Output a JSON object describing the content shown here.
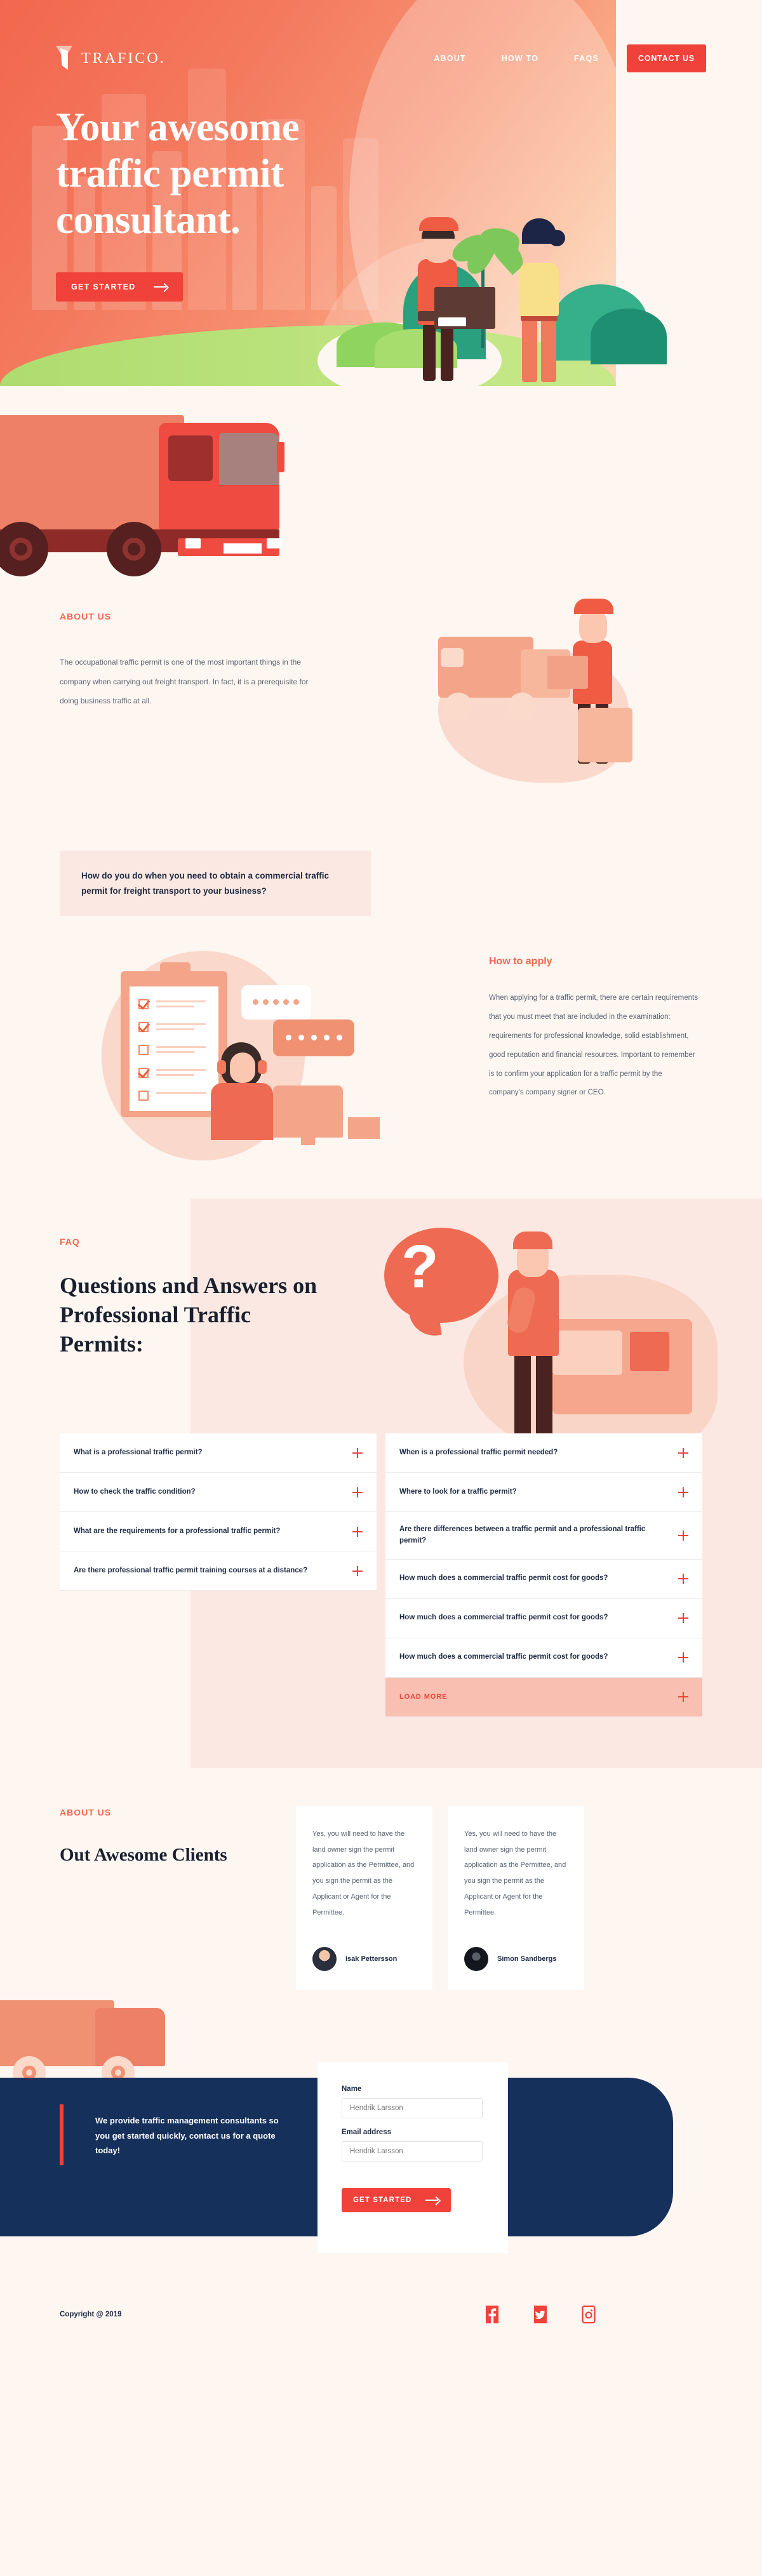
{
  "brand": {
    "name": "TRAFICO.",
    "logo_icon": "lightning-flag-logo"
  },
  "nav": {
    "links": [
      {
        "label": "ABOUT"
      },
      {
        "label": "HOW TO"
      },
      {
        "label": "FAQS"
      }
    ],
    "cta": "CONTACT US"
  },
  "hero": {
    "title": "Your awesome traffic permit consultant.",
    "cta": "GET STARTED"
  },
  "about": {
    "eyebrow": "ABOUT US",
    "body": "The occupational traffic permit is one of the most important things in the company when carrying out freight transport. In fact, it is a prerequisite for doing business traffic at all."
  },
  "callout": {
    "text": "How do you do when you need to obtain a commercial traffic permit for freight transport to your business?"
  },
  "howto": {
    "title": "How to apply",
    "body": "When applying for a traffic permit, there are certain requirements that you must meet that are included in the examination: requirements for professional knowledge, solid establishment, good reputation and financial resources. Important to remember is to confirm your application for a traffic permit by the company's company signer or CEO."
  },
  "faq": {
    "eyebrow": "FAQ",
    "title": "Questions and Answers on Professional Traffic Permits:",
    "left_items": [
      "What is a professional traffic permit?",
      "How to check the traffic condition?",
      "What are the requirements for a professional traffic permit?",
      "Are there professional traffic permit training courses at a distance?"
    ],
    "right_items": [
      "When is a professional traffic permit needed?",
      "Where to look for a traffic permit?",
      "Are there differences between a traffic permit and a professional traffic permit?",
      "How much does a commercial traffic permit cost for goods?",
      "How much does a commercial traffic permit cost for goods?",
      "How much does a commercial traffic permit cost for goods?"
    ],
    "load_more": "LOAD MORE"
  },
  "clients": {
    "eyebrow": "ABOUT US",
    "title": "Out Awesome Clients",
    "cards": [
      {
        "quote": "Yes, you will need to have the land owner sign the permit application as the Permittee, and you sign the permit as the Applicant or Agent for the Permittee.",
        "name": "Isak Pettersson"
      },
      {
        "quote": "Yes, you will need to have the land owner sign the permit application as the Permittee, and you sign the permit as the Applicant or Agent for the Permittee.",
        "name": "Simon Sandbergs"
      }
    ]
  },
  "contact": {
    "headline": "We provide traffic management consultants so you get started quickly, contact us for a quote today!",
    "name_label": "Name",
    "name_placeholder": "Hendrik Larsson",
    "email_label": "Email address",
    "email_placeholder": "Hendrik Larsson",
    "cta": "GET STARTED"
  },
  "footer": {
    "copyright": "Copyright @ 2019",
    "socials": [
      {
        "name": "facebook-icon"
      },
      {
        "name": "twitter-icon"
      },
      {
        "name": "instagram-icon"
      }
    ]
  },
  "colors": {
    "accent_red": "#f0413a",
    "coral": "#f2674f",
    "navy": "#16305c",
    "cream": "#fdf6f1",
    "pink_panel": "#fbe8e2"
  }
}
